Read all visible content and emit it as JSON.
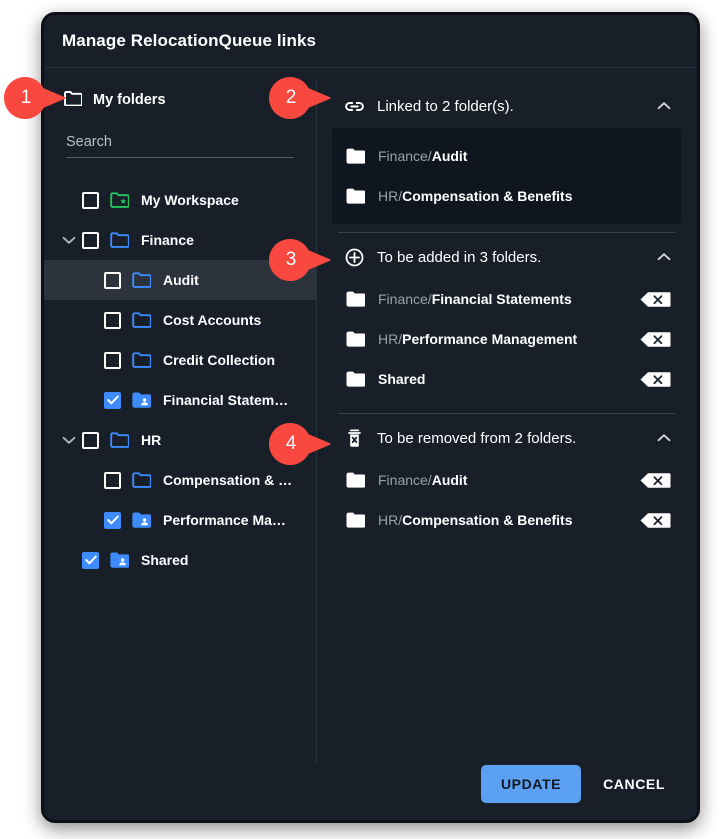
{
  "dialog": {
    "title": "Manage RelocationQueue links"
  },
  "left_panel": {
    "header": {
      "label": "My folders",
      "icon": "folder-icon"
    },
    "search": {
      "placeholder": "Search",
      "value": ""
    },
    "tree": [
      {
        "label": "My Workspace",
        "depth": 0,
        "checked": false,
        "expandable": false,
        "icon": "folder-star-icon",
        "selected": false
      },
      {
        "label": "Finance",
        "depth": 0,
        "checked": false,
        "expandable": true,
        "expanded": true,
        "icon": "folder-icon",
        "selected": false
      },
      {
        "label": "Audit",
        "depth": 1,
        "checked": false,
        "expandable": false,
        "icon": "folder-icon",
        "selected": true
      },
      {
        "label": "Cost Accounts",
        "depth": 1,
        "checked": false,
        "expandable": false,
        "icon": "folder-icon",
        "selected": false
      },
      {
        "label": "Credit Collection",
        "depth": 1,
        "checked": false,
        "expandable": false,
        "icon": "folder-icon",
        "selected": false
      },
      {
        "label": "Financial Statem…",
        "depth": 1,
        "checked": true,
        "expandable": false,
        "icon": "folder-shared-icon",
        "selected": false
      },
      {
        "label": "HR",
        "depth": 0,
        "checked": false,
        "expandable": true,
        "expanded": true,
        "icon": "folder-icon",
        "selected": false
      },
      {
        "label": "Compensation & …",
        "depth": 1,
        "checked": false,
        "expandable": false,
        "icon": "folder-icon",
        "selected": false
      },
      {
        "label": "Performance Ma…",
        "depth": 1,
        "checked": true,
        "expandable": false,
        "icon": "folder-shared-icon",
        "selected": false
      },
      {
        "label": "Shared",
        "depth": 0,
        "checked": true,
        "expandable": false,
        "icon": "folder-shared-icon",
        "selected": false
      }
    ]
  },
  "right_panel": {
    "sections": [
      {
        "id": "linked",
        "icon": "link-icon",
        "title": "Linked to 2 folder(s).",
        "collapsed": false,
        "boxed": true,
        "items": [
          {
            "prefix": "Finance/",
            "leaf": "Audit",
            "removable": false
          },
          {
            "prefix": "HR/",
            "leaf": "Compensation & Benefits",
            "removable": false
          }
        ]
      },
      {
        "id": "to-add",
        "icon": "plus-circle-icon",
        "title": "To be added in 3 folders.",
        "collapsed": false,
        "boxed": false,
        "items": [
          {
            "prefix": "Finance/",
            "leaf": "Financial Statements",
            "removable": true
          },
          {
            "prefix": "HR/",
            "leaf": "Performance Management",
            "removable": true
          },
          {
            "prefix": "",
            "leaf": "Shared",
            "removable": true
          }
        ]
      },
      {
        "id": "to-remove",
        "icon": "trash-x-icon",
        "title": "To be removed from 2 folders.",
        "collapsed": false,
        "boxed": false,
        "items": [
          {
            "prefix": "Finance/",
            "leaf": "Audit",
            "removable": true
          },
          {
            "prefix": "HR/",
            "leaf": "Compensation & Benefits",
            "removable": true
          }
        ]
      }
    ]
  },
  "footer": {
    "update_label": "UPDATE",
    "cancel_label": "CANCEL"
  },
  "callouts": [
    {
      "number": "1",
      "target": "my-folders-header"
    },
    {
      "number": "2",
      "target": "linked-section-header"
    },
    {
      "number": "3",
      "target": "to-add-section-header"
    },
    {
      "number": "4",
      "target": "to-remove-section-header"
    }
  ],
  "colors": {
    "dialog_bg": "#181f29",
    "accent_blue": "#3d8bfd",
    "update_button": "#5ba0f2",
    "workspace_green": "#22c55e",
    "callout_red": "#f8483f",
    "selected_row": "#2c333d",
    "boxed_bg": "#10161f"
  }
}
